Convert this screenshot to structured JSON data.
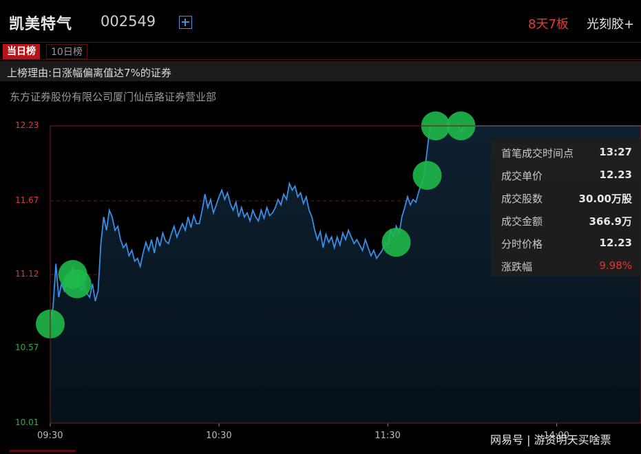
{
  "header": {
    "stock_name": "凯美特气",
    "stock_code": "002549",
    "streak": "8天7板",
    "concept": "光刻胶+"
  },
  "tabs": [
    {
      "label": "当日榜",
      "active": true
    },
    {
      "label": "10日榜",
      "active": false
    }
  ],
  "reason": "上榜理由:日涨幅偏离值达7%的证券",
  "broker": "东方证券股份有限公司厦门仙岳路证券营业部",
  "tooltip": {
    "rows": [
      {
        "label": "首笔成交时间点",
        "value": "13:27"
      },
      {
        "label": "成交单价",
        "value": "12.23"
      },
      {
        "label": "成交股数",
        "value": "30.00万股"
      },
      {
        "label": "成交金额",
        "value": "366.9万"
      },
      {
        "label": "分时价格",
        "value": "12.23"
      },
      {
        "label": "涨跌幅",
        "value": "9.98%"
      }
    ]
  },
  "watermark": "网易号 | 游资明天买啥票",
  "colors": {
    "line": "#3a8ee6",
    "marker": "#1fb84a",
    "up": "#e8382f",
    "down": "#2fb04a",
    "grid": "#6b1a1a"
  },
  "chart_data": {
    "type": "line",
    "y_ticks": [
      "12.23",
      "11.67",
      "11.12",
      "10.57",
      "10.01"
    ],
    "ylim": [
      10.01,
      12.23
    ],
    "x_ticks": [
      "09:30",
      "10:30",
      "11:30",
      "14:00"
    ],
    "x_tick_minutes": [
      0,
      60,
      120,
      180
    ],
    "xlim_minutes": [
      0,
      210
    ],
    "series": [
      {
        "points": [
          [
            0,
            10.75
          ],
          [
            1,
            10.88
          ],
          [
            2,
            11.2
          ],
          [
            3,
            10.95
          ],
          [
            4,
            11.05
          ],
          [
            5,
            11.0
          ],
          [
            6,
            11.12
          ],
          [
            7,
            11.05
          ],
          [
            8,
            11.18
          ],
          [
            9,
            11.07
          ],
          [
            10,
            11.1
          ],
          [
            11,
            11.0
          ],
          [
            12,
            11.04
          ],
          [
            13,
            10.98
          ],
          [
            14,
            10.95
          ],
          [
            15,
            11.05
          ],
          [
            16,
            10.92
          ],
          [
            17,
            11.0
          ],
          [
            18,
            11.35
          ],
          [
            19,
            11.55
          ],
          [
            20,
            11.45
          ],
          [
            21,
            11.6
          ],
          [
            22,
            11.55
          ],
          [
            23,
            11.45
          ],
          [
            24,
            11.48
          ],
          [
            25,
            11.38
          ],
          [
            26,
            11.32
          ],
          [
            27,
            11.35
          ],
          [
            28,
            11.26
          ],
          [
            29,
            11.3
          ],
          [
            30,
            11.22
          ],
          [
            31,
            11.24
          ],
          [
            32,
            11.18
          ],
          [
            33,
            11.28
          ],
          [
            34,
            11.36
          ],
          [
            35,
            11.3
          ],
          [
            36,
            11.38
          ],
          [
            37,
            11.28
          ],
          [
            38,
            11.4
          ],
          [
            39,
            11.33
          ],
          [
            40,
            11.43
          ],
          [
            41,
            11.37
          ],
          [
            42,
            11.35
          ],
          [
            43,
            11.42
          ],
          [
            44,
            11.48
          ],
          [
            45,
            11.4
          ],
          [
            46,
            11.45
          ],
          [
            47,
            11.5
          ],
          [
            48,
            11.45
          ],
          [
            49,
            11.55
          ],
          [
            50,
            11.47
          ],
          [
            51,
            11.56
          ],
          [
            52,
            11.5
          ],
          [
            53,
            11.5
          ],
          [
            54,
            11.6
          ],
          [
            55,
            11.72
          ],
          [
            56,
            11.62
          ],
          [
            57,
            11.68
          ],
          [
            58,
            11.58
          ],
          [
            59,
            11.64
          ],
          [
            60,
            11.7
          ],
          [
            61,
            11.75
          ],
          [
            62,
            11.68
          ],
          [
            63,
            11.73
          ],
          [
            64,
            11.65
          ],
          [
            65,
            11.6
          ],
          [
            66,
            11.66
          ],
          [
            67,
            11.55
          ],
          [
            68,
            11.62
          ],
          [
            69,
            11.55
          ],
          [
            70,
            11.58
          ],
          [
            71,
            11.52
          ],
          [
            72,
            11.6
          ],
          [
            73,
            11.55
          ],
          [
            74,
            11.52
          ],
          [
            75,
            11.6
          ],
          [
            76,
            11.54
          ],
          [
            77,
            11.62
          ],
          [
            78,
            11.56
          ],
          [
            79,
            11.58
          ],
          [
            80,
            11.62
          ],
          [
            81,
            11.68
          ],
          [
            82,
            11.64
          ],
          [
            83,
            11.72
          ],
          [
            84,
            11.68
          ],
          [
            85,
            11.8
          ],
          [
            86,
            11.75
          ],
          [
            87,
            11.78
          ],
          [
            88,
            11.7
          ],
          [
            89,
            11.73
          ],
          [
            90,
            11.65
          ],
          [
            91,
            11.7
          ],
          [
            92,
            11.6
          ],
          [
            93,
            11.55
          ],
          [
            94,
            11.45
          ],
          [
            95,
            11.38
          ],
          [
            96,
            11.44
          ],
          [
            97,
            11.32
          ],
          [
            98,
            11.42
          ],
          [
            99,
            11.36
          ],
          [
            100,
            11.4
          ],
          [
            101,
            11.32
          ],
          [
            102,
            11.4
          ],
          [
            103,
            11.34
          ],
          [
            104,
            11.43
          ],
          [
            105,
            11.38
          ],
          [
            106,
            11.45
          ],
          [
            107,
            11.4
          ],
          [
            108,
            11.35
          ],
          [
            109,
            11.38
          ],
          [
            110,
            11.34
          ],
          [
            111,
            11.3
          ],
          [
            112,
            11.38
          ],
          [
            113,
            11.32
          ],
          [
            114,
            11.26
          ],
          [
            115,
            11.3
          ],
          [
            116,
            11.24
          ],
          [
            117,
            11.27
          ],
          [
            118,
            11.3
          ],
          [
            119,
            11.36
          ],
          [
            120,
            11.34
          ],
          [
            121,
            11.45
          ],
          [
            122,
            11.4
          ],
          [
            123,
            11.48
          ],
          [
            124,
            11.42
          ],
          [
            125,
            11.55
          ],
          [
            126,
            11.62
          ],
          [
            127,
            11.7
          ],
          [
            128,
            11.64
          ],
          [
            129,
            11.68
          ],
          [
            130,
            11.66
          ],
          [
            131,
            11.74
          ],
          [
            132,
            11.8
          ],
          [
            133,
            11.88
          ],
          [
            134,
            12.05
          ],
          [
            135,
            12.23
          ],
          [
            137,
            12.23
          ],
          [
            139,
            12.23
          ],
          [
            145,
            12.23
          ],
          [
            146,
            12.18
          ],
          [
            147,
            12.23
          ],
          [
            210,
            12.23
          ]
        ]
      }
    ],
    "markers": [
      {
        "t": 0,
        "price": 10.75
      },
      {
        "t": 8,
        "price": 11.12
      },
      {
        "t": 9.5,
        "price": 11.05
      },
      {
        "t": 123,
        "price": 11.36
      },
      {
        "t": 137,
        "price": 12.23
      },
      {
        "t": 134,
        "price": 11.86
      },
      {
        "t": 146,
        "price": 12.23
      }
    ]
  }
}
